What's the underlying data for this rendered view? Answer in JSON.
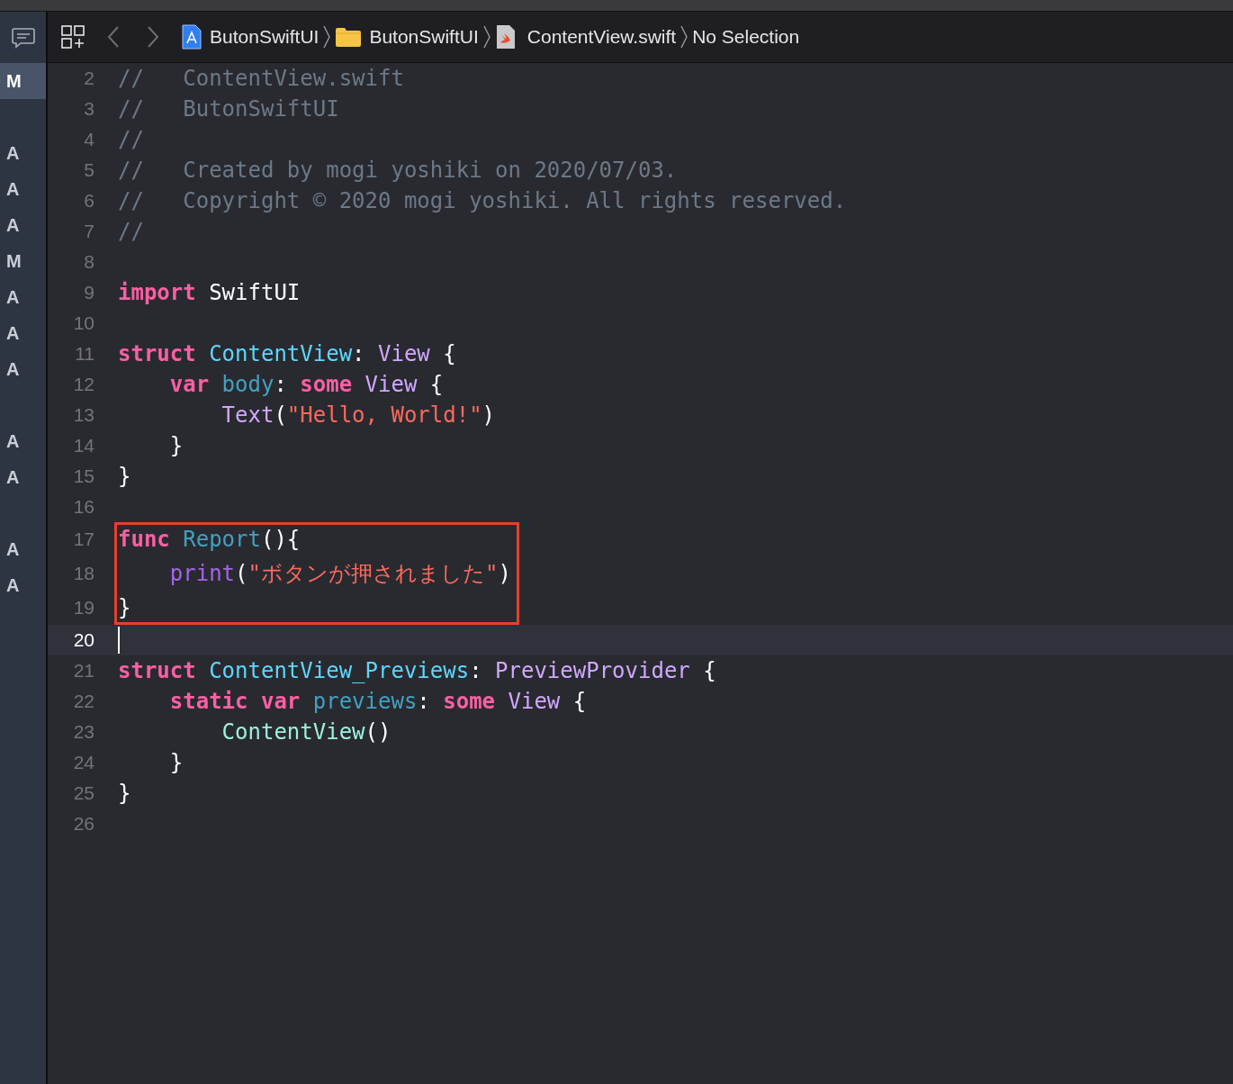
{
  "breadcrumb": [
    {
      "label": "ButonSwiftUI",
      "kind": "project"
    },
    {
      "label": "ButonSwiftUI",
      "kind": "folder"
    },
    {
      "label": "ContentView.swift",
      "kind": "file"
    },
    {
      "label": "No Selection",
      "kind": "plain"
    }
  ],
  "source_control": [
    {
      "kind": "status",
      "letter": "M",
      "selected": true
    },
    {
      "kind": "spacer"
    },
    {
      "kind": "status",
      "letter": "A",
      "selected": false
    },
    {
      "kind": "status",
      "letter": "A",
      "selected": false
    },
    {
      "kind": "status",
      "letter": "A",
      "selected": false
    },
    {
      "kind": "status",
      "letter": "M",
      "selected": false
    },
    {
      "kind": "status",
      "letter": "A",
      "selected": false
    },
    {
      "kind": "status",
      "letter": "A",
      "selected": false
    },
    {
      "kind": "status",
      "letter": "A",
      "selected": false
    },
    {
      "kind": "spacer"
    },
    {
      "kind": "status",
      "letter": "A",
      "selected": false
    },
    {
      "kind": "status",
      "letter": "A",
      "selected": false
    },
    {
      "kind": "spacer"
    },
    {
      "kind": "status",
      "letter": "A",
      "selected": false
    },
    {
      "kind": "status",
      "letter": "A",
      "selected": false
    }
  ],
  "lines": [
    {
      "number": "2",
      "current": false,
      "boxed": false,
      "tokens": [
        {
          "kind": "comment",
          "text": "//   ContentView.swift"
        }
      ]
    },
    {
      "number": "3",
      "current": false,
      "boxed": false,
      "tokens": [
        {
          "kind": "comment",
          "text": "//   ButonSwiftUI"
        }
      ]
    },
    {
      "number": "4",
      "current": false,
      "boxed": false,
      "tokens": [
        {
          "kind": "comment",
          "text": "//"
        }
      ]
    },
    {
      "number": "5",
      "current": false,
      "boxed": false,
      "tokens": [
        {
          "kind": "comment",
          "text": "//   Created by mogi yoshiki on 2020/07/03."
        }
      ]
    },
    {
      "number": "6",
      "current": false,
      "boxed": false,
      "tokens": [
        {
          "kind": "comment",
          "text": "//   Copyright © 2020 mogi yoshiki. All rights reserved."
        }
      ]
    },
    {
      "number": "7",
      "current": false,
      "boxed": false,
      "tokens": [
        {
          "kind": "comment",
          "text": "//"
        }
      ]
    },
    {
      "number": "8",
      "current": false,
      "boxed": false
    },
    {
      "number": "9",
      "current": false,
      "boxed": false,
      "tokens": [
        {
          "kind": "keyword",
          "text": "import"
        },
        {
          "kind": "plain",
          "text": " SwiftUI"
        }
      ]
    },
    {
      "number": "10",
      "current": false,
      "boxed": false
    },
    {
      "number": "11",
      "current": false,
      "boxed": false,
      "tokens": [
        {
          "kind": "keyword",
          "text": "struct"
        },
        {
          "kind": "type_decl",
          "text": " ContentView"
        },
        {
          "kind": "plain",
          "text": ": "
        },
        {
          "kind": "type",
          "text": "View"
        },
        {
          "kind": "plain",
          "text": " {"
        }
      ]
    },
    {
      "number": "12",
      "current": false,
      "boxed": false,
      "tokens": [
        {
          "kind": "keyword",
          "text": "    var"
        },
        {
          "kind": "decl",
          "text": " body"
        },
        {
          "kind": "plain",
          "text": ": "
        },
        {
          "kind": "keyword",
          "text": "some"
        },
        {
          "kind": "type",
          "text": " View"
        },
        {
          "kind": "plain",
          "text": " {"
        }
      ]
    },
    {
      "number": "13",
      "current": false,
      "boxed": false,
      "tokens": [
        {
          "kind": "type",
          "text": "        Text"
        },
        {
          "kind": "plain",
          "text": "("
        },
        {
          "kind": "string",
          "text": "\"Hello, World!\""
        },
        {
          "kind": "plain",
          "text": ")"
        }
      ]
    },
    {
      "number": "14",
      "current": false,
      "boxed": false,
      "tokens": [
        {
          "kind": "plain",
          "text": "    }"
        }
      ]
    },
    {
      "number": "15",
      "current": false,
      "boxed": false,
      "tokens": [
        {
          "kind": "plain",
          "text": "}"
        }
      ]
    },
    {
      "number": "16",
      "current": false,
      "boxed": false
    },
    {
      "number": "17",
      "current": false,
      "boxed": true,
      "tokens": [
        {
          "kind": "keyword",
          "text": "func"
        },
        {
          "kind": "decl",
          "text": " Report"
        },
        {
          "kind": "plain",
          "text": "(){"
        }
      ]
    },
    {
      "number": "18",
      "current": false,
      "boxed": true,
      "tokens": [
        {
          "kind": "library",
          "text": "    print"
        },
        {
          "kind": "plain",
          "text": "("
        },
        {
          "kind": "string",
          "text": "\"ボタンが押されました\""
        },
        {
          "kind": "plain",
          "text": ")"
        }
      ]
    },
    {
      "number": "19",
      "current": false,
      "boxed": true,
      "tokens": [
        {
          "kind": "plain",
          "text": "}"
        }
      ]
    },
    {
      "number": "20",
      "current": true,
      "boxed": false
    },
    {
      "number": "21",
      "current": false,
      "boxed": false,
      "tokens": [
        {
          "kind": "keyword",
          "text": "struct"
        },
        {
          "kind": "type_decl",
          "text": " ContentView_Previews"
        },
        {
          "kind": "plain",
          "text": ": "
        },
        {
          "kind": "type",
          "text": "PreviewProvider"
        },
        {
          "kind": "plain",
          "text": " {"
        }
      ]
    },
    {
      "number": "22",
      "current": false,
      "boxed": false,
      "tokens": [
        {
          "kind": "keyword",
          "text": "    static var"
        },
        {
          "kind": "decl",
          "text": " previews"
        },
        {
          "kind": "plain",
          "text": ": "
        },
        {
          "kind": "keyword",
          "text": "some"
        },
        {
          "kind": "type",
          "text": " View"
        },
        {
          "kind": "plain",
          "text": " {"
        }
      ]
    },
    {
      "number": "23",
      "current": false,
      "boxed": false,
      "tokens": [
        {
          "kind": "project",
          "text": "        ContentView"
        },
        {
          "kind": "plain",
          "text": "()"
        }
      ]
    },
    {
      "number": "24",
      "current": false,
      "boxed": false,
      "tokens": [
        {
          "kind": "plain",
          "text": "    }"
        }
      ]
    },
    {
      "number": "25",
      "current": false,
      "boxed": false,
      "tokens": [
        {
          "kind": "plain",
          "text": "}"
        }
      ]
    },
    {
      "number": "26",
      "current": false,
      "boxed": false
    }
  ]
}
